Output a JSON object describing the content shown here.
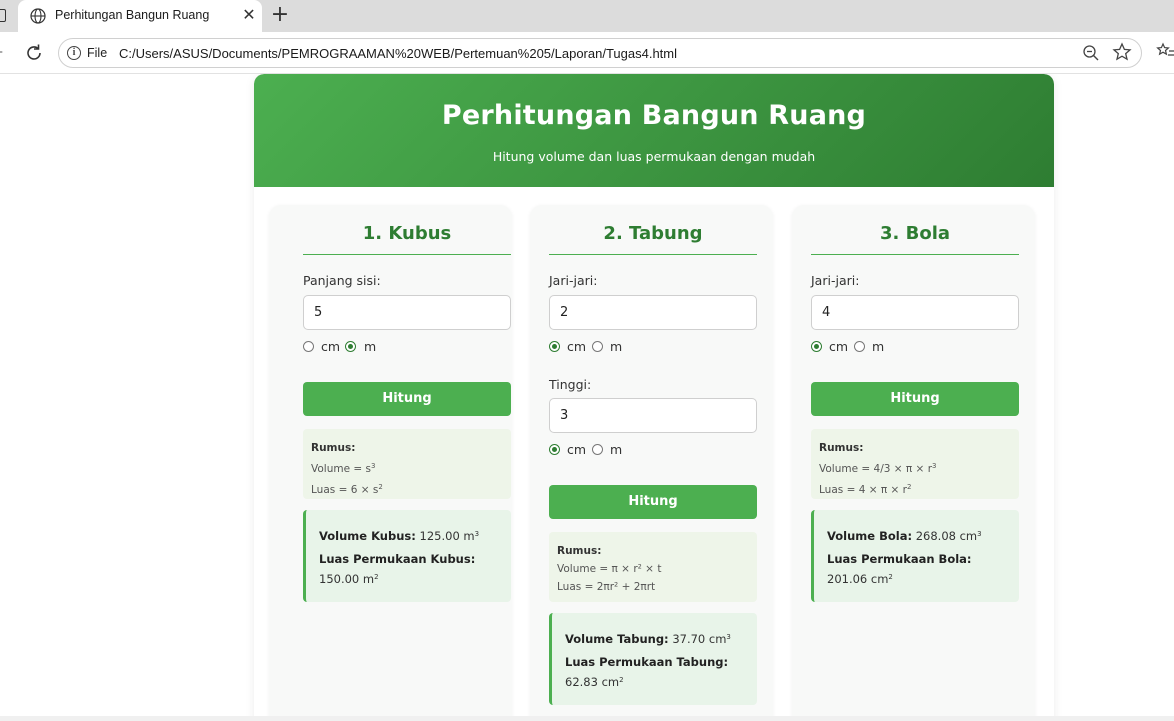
{
  "browser": {
    "tab_title": "Perhitungan Bangun Ruang",
    "close_glyph": "✕",
    "new_tab_glyph": "+",
    "file_label": "File",
    "url": "C:/Users/ASUS/Documents/PEMROGRAAMAN%20WEB/Pertemuan%205/Laporan/Tugas4.html",
    "icons": [
      "globe-icon",
      "reload-icon",
      "info-icon",
      "zoom-out-icon",
      "star-icon",
      "favorites-list-icon"
    ]
  },
  "header": {
    "title": "Perhitungan Bangun Ruang",
    "subtitle": "Hitung volume dan luas permukaan dengan mudah"
  },
  "colors": {
    "accent": "#4caf50",
    "accent_dark": "#2e7d32",
    "formula_bg": "#eef5e9",
    "result_bg": "#e8f4e9"
  },
  "cards": {
    "kubus": {
      "title": "1. Kubus",
      "label": "Panjang sisi:",
      "value": "5",
      "unit_cm": "cm",
      "unit_m": "m",
      "selected_unit": "m",
      "button": "Hitung",
      "formula_heading": "Rumus:",
      "formula_volume": "Volume = s",
      "formula_luas": "Luas = 6 × s",
      "result_volume_label": "Volume Kubus:",
      "result_volume_value": "125.00 m",
      "result_luas_label": "Luas Permukaan Kubus:",
      "result_luas_value": "150.00 m"
    },
    "tabung": {
      "title": "2. Tabung",
      "label_r": "Jari-jari:",
      "value_r": "2",
      "label_t": "Tinggi:",
      "value_t": "3",
      "unit_cm": "cm",
      "unit_m": "m",
      "selected_unit_r": "cm",
      "selected_unit_t": "cm",
      "button": "Hitung",
      "formula_heading": "Rumus:",
      "formula_volume": "Volume = π × r² × t",
      "formula_luas": "Luas = 2πr² + 2πrt",
      "result_volume_label": "Volume Tabung:",
      "result_volume_value": "37.70 cm",
      "result_luas_label": "Luas Permukaan Tabung:",
      "result_luas_value": "62.83 cm"
    },
    "bola": {
      "title": "3. Bola",
      "label": "Jari-jari:",
      "value": "4",
      "unit_cm": "cm",
      "unit_m": "m",
      "selected_unit": "cm",
      "button": "Hitung",
      "formula_heading": "Rumus:",
      "formula_volume": "Volume = 4/3 × π × r",
      "formula_luas": "Luas = 4 × π × r",
      "result_volume_label": "Volume Bola:",
      "result_volume_value": "268.08 cm",
      "result_luas_label": "Luas Permukaan Bola:",
      "result_luas_value": "201.06 cm"
    },
    "sup_2": "2",
    "sup_3": "3"
  }
}
